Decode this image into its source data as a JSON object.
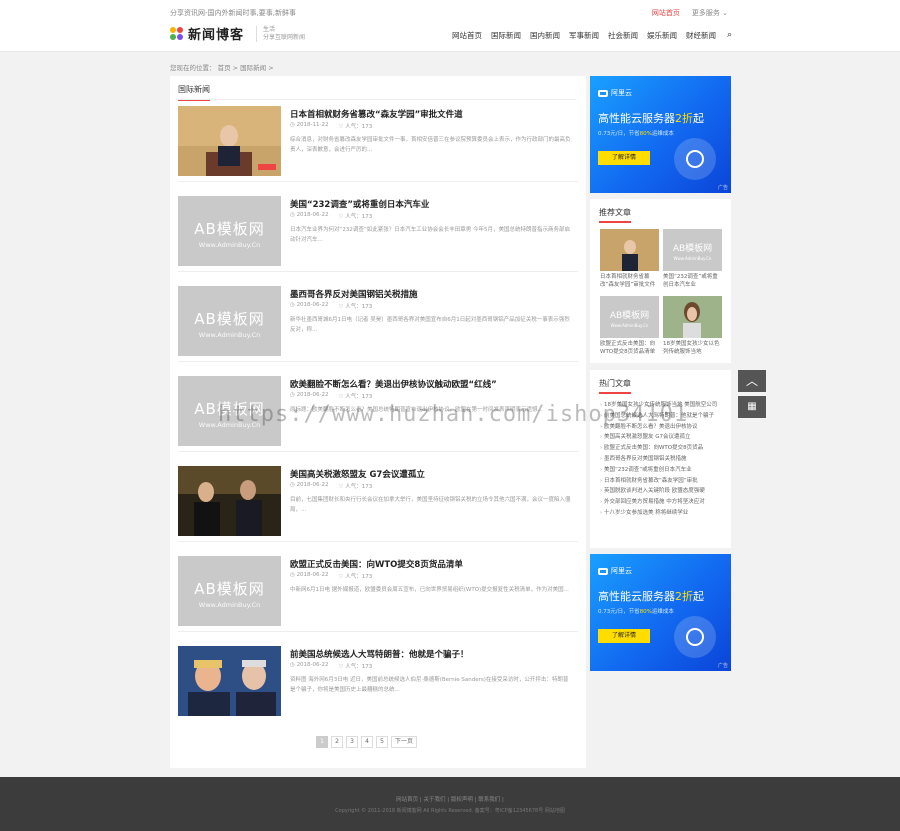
{
  "header": {
    "tagline": "分享资讯网-国内外新闻时事,要事,新鲜事",
    "top_links": {
      "home": "网站首页",
      "more": "更多服务 ⌄"
    },
    "logo": {
      "text": "新闻博客",
      "sub1": "生活",
      "sub2": "分享互联网新闻"
    },
    "nav": [
      "网站首页",
      "国际新闻",
      "国内新闻",
      "军事新闻",
      "社会新闻",
      "娱乐新闻",
      "财经新闻"
    ]
  },
  "breadcrumb": "您现在的位置：  首页  >  国际新闻  >",
  "main": {
    "section_title": "国际新闻",
    "placeholder": {
      "big": "AB模板网",
      "small": "Www.AdminBuy.Cn"
    },
    "articles": [
      {
        "title": "日本首相就财务省篡改“森友学园”审批文件道",
        "date": "2018-11-22",
        "views": "人气：173",
        "desc": "综合消息，对财务省篡改森友学园审批文件一事，首相安倍晋三在参议院预算委员会上表示，作为行政部门的最高负责人，深表歉意，会进行严厉的..."
      },
      {
        "title": "美国“232调查”或将重创日本汽车业",
        "date": "2018-06-22",
        "views": "人气：173",
        "desc": "日本汽车业界为何对“232调查”如此紧张？日本汽车工业协会会长丰田章男 今年5月，美国总统特朗普指示商务部启动针对汽车..."
      },
      {
        "title": "墨西哥各界反对美国钢铝关税措施",
        "date": "2018-06-22",
        "views": "人气：173",
        "desc": "新华社墨西哥城6月1日电（记者 吴昊）墨西哥各界对美国宣布自6月1日起对墨西哥钢铝产品加征关税一事表示强烈反对，称..."
      },
      {
        "title": "欧美翻脸不断怎么看？美退出伊核协议触动欧盟“红线”",
        "date": "2018-06-22",
        "views": "人气：173",
        "desc": "原标题：欧美翻脸不断怎么看？美国总统特朗普宣布退出伊核协议，欧盟在第一时间发表声明表示遗憾..."
      },
      {
        "title": "美国高关税激怒盟友 G7会议遭孤立",
        "date": "2018-06-22",
        "views": "人气：173",
        "desc": "目前，七国集团财长和央行行长会议在加拿大举行，美国坚持征收钢铝关税的立场令其他六国不满，会议一度陷入僵局，..."
      },
      {
        "title": "欧盟正式反击美国：向WTO提交8页货品清单",
        "date": "2018-06-22",
        "views": "人气：173",
        "desc": "中新网6月1日电 据外媒报道，欧盟委员会周五宣布，已向世界贸易组织(WTO)提交报复性关税清单，作为对美国..."
      },
      {
        "title": "前美国总统候选人大骂特朗普：他就是个骗子！",
        "date": "2018-06-22",
        "views": "人气：173",
        "desc": "资料图 海外网6月3日电 近日，美国前总统候选人伯尼·桑德斯(Bernie Sanders)在接受采访时，公开抨击：特朗普是个骗子，你将是美国历史上最糟糕的总统..."
      }
    ],
    "pager": [
      "1",
      "2",
      "3",
      "4",
      "5",
      "下一页"
    ]
  },
  "ad": {
    "brand": "阿里云",
    "headline_pre": "高性能云服务器",
    "headline_em": "2折",
    "headline_post": "起",
    "sub_pre": "0.73元/日，节省",
    "sub_em": "80%",
    "sub_post": "运维成本",
    "button": "了解详情",
    "tag": "广告"
  },
  "recommend": {
    "title": "推荐文章",
    "items": [
      "日本首相就财务省篡改“森友学园”审批文件",
      "美国“232调查”或将重创日本汽车业",
      "欧盟正式反击美国：向WTO提交8页货品清单",
      "18岁美国女孩少女以色列传统服饰当地"
    ]
  },
  "hot": {
    "title": "热门文章",
    "items": [
      "18岁美国女孩少女传统服饰当地 美国航空公司",
      "前美国总统候选人大骂特朗普：他就是个骗子",
      "欧美翻脸不断怎么看？美退出伊核协议",
      "美国高关税激怒盟友 G7会议遭孤立",
      "欧盟正式反击美国：向WTO提交8页货品",
      "墨西哥各界反对美国钢铝关税措施",
      "美国“232调查”或将重创日本汽车业",
      "日本首相就财务省篡改“森友学园”审批",
      "英国脱欧谈判进入关键阶段 欧盟态度强硬",
      "外交部回应美方贸易措施 中方将坚决应对",
      "十八岁少女参加选美 称将继续学业"
    ]
  },
  "footer": {
    "links": "网站首页  |  关于我们  |  版权声明  |  联系我们  |",
    "copy": "Copyright © 2011-2018 新闻博客网 All Rights Reserved. 备案号：粤ICP备12345678号  网站地图"
  },
  "watermark": "https://www.huzhan.com/ishop34101"
}
